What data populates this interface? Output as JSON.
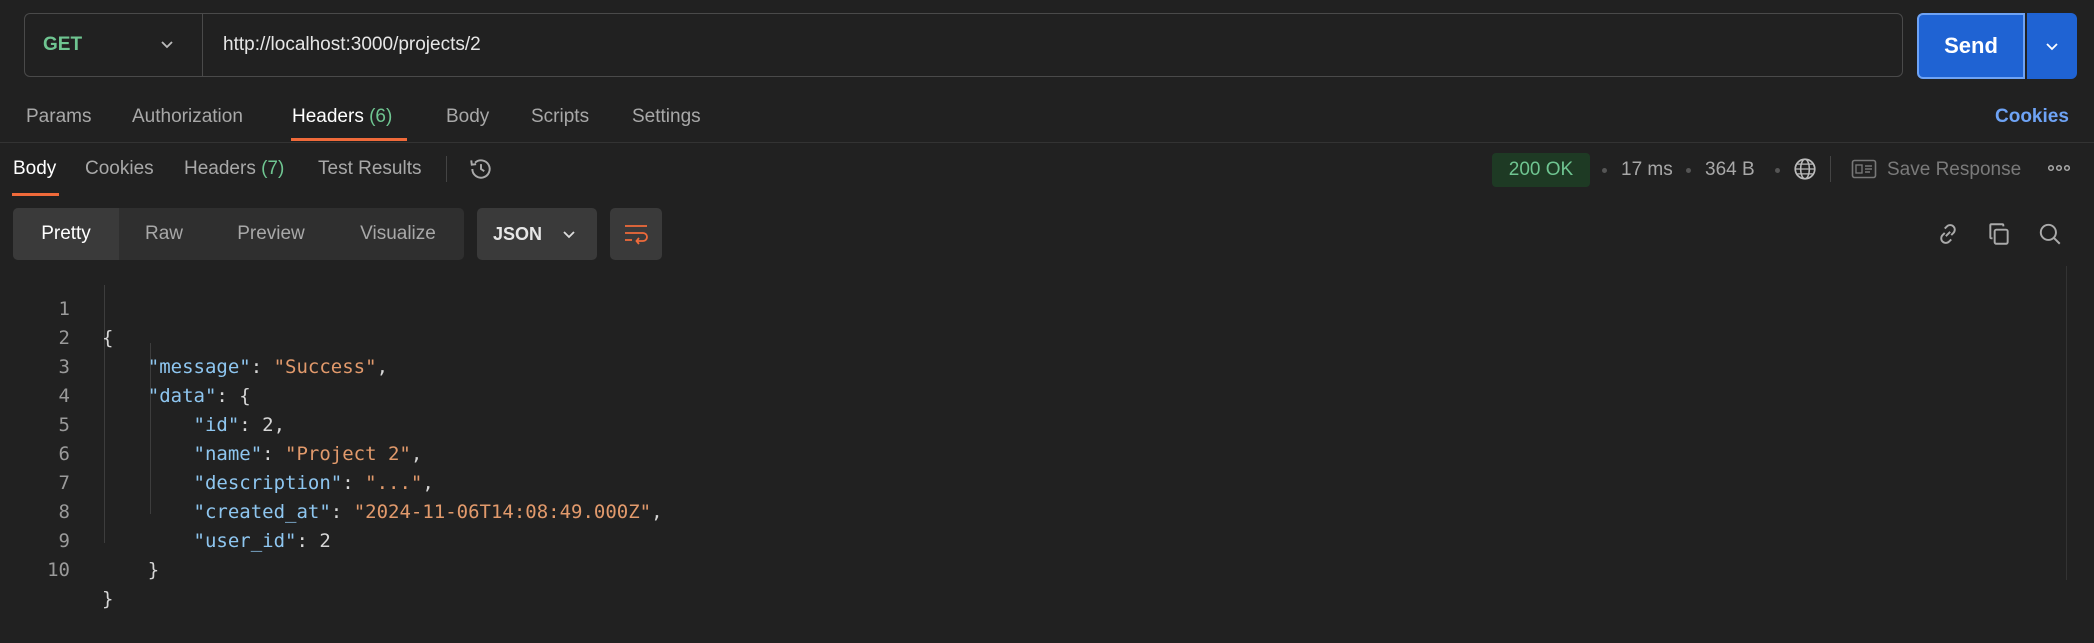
{
  "request": {
    "method": "GET",
    "url": "http://localhost:3000/projects/2",
    "send_label": "Send"
  },
  "request_tabs": [
    {
      "label": "Params"
    },
    {
      "label": "Authorization"
    },
    {
      "label": "Headers",
      "count": "(6)"
    },
    {
      "label": "Body"
    },
    {
      "label": "Scripts"
    },
    {
      "label": "Settings"
    }
  ],
  "cookies_link": "Cookies",
  "response_tabs": [
    {
      "label": "Body"
    },
    {
      "label": "Cookies"
    },
    {
      "label": "Headers",
      "count": "(7)"
    },
    {
      "label": "Test Results"
    }
  ],
  "response_meta": {
    "status": "200 OK",
    "time": "17 ms",
    "size": "364 B",
    "save_label": "Save Response"
  },
  "format_tabs": [
    "Pretty",
    "Raw",
    "Preview",
    "Visualize"
  ],
  "language": "JSON",
  "colors": {
    "accent": "#f06a3a",
    "send": "#1f63d3",
    "ok": "#6fc591",
    "link": "#6ea3f5"
  },
  "code_lines": [
    {
      "num": "1"
    },
    {
      "num": "2",
      "key": "\"message\"",
      "str": "\"Success\""
    },
    {
      "num": "3",
      "key": "\"data\""
    },
    {
      "num": "4",
      "key": "\"id\"",
      "val": "2"
    },
    {
      "num": "5",
      "key": "\"name\"",
      "str": "\"Project 2\""
    },
    {
      "num": "6",
      "key": "\"description\"",
      "str": "\"...\""
    },
    {
      "num": "7",
      "key": "\"created_at\"",
      "str": "\"2024-11-06T14:08:49.000Z\""
    },
    {
      "num": "8",
      "key": "\"user_id\"",
      "val": "2"
    },
    {
      "num": "9"
    },
    {
      "num": "10"
    }
  ]
}
